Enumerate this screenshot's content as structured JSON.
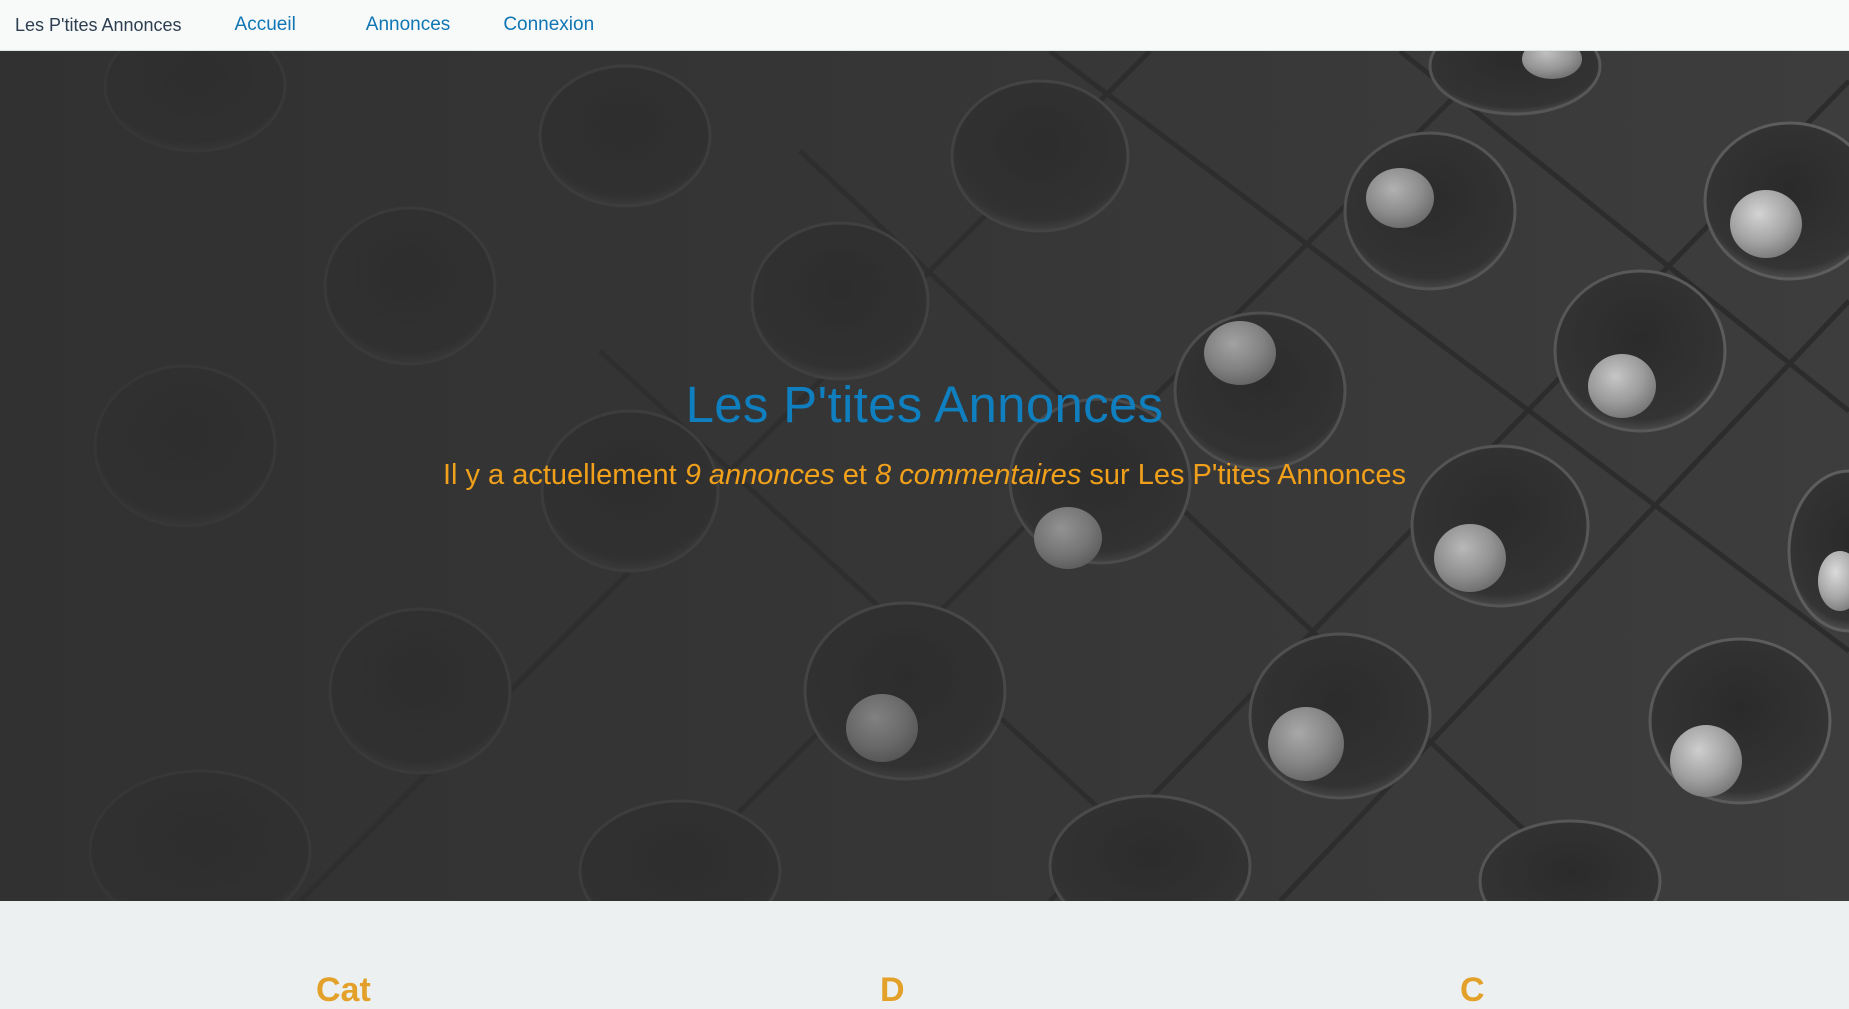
{
  "navbar": {
    "brand": "Les P'tites Annonces",
    "links": [
      {
        "label": "Accueil"
      },
      {
        "label": "Annonces"
      },
      {
        "label": "Connexion"
      }
    ]
  },
  "hero": {
    "title": "Les P'tites Annonces",
    "subtitle": {
      "prefix": "Il y a actuellement ",
      "ads_count": "9 annonces",
      "middle": " et ",
      "comments_count": "8 commentaires",
      "suffix": " sur Les P'tites Annonces"
    }
  },
  "lower": {
    "headings": [
      "Cat",
      "D",
      "C"
    ]
  },
  "colors": {
    "navbar_bg": "#f8f9f9",
    "link": "#0f76b3",
    "hero_title": "#0f7fbf",
    "hero_subtitle": "#f0a01a",
    "page_bg": "#ecf0f1"
  }
}
